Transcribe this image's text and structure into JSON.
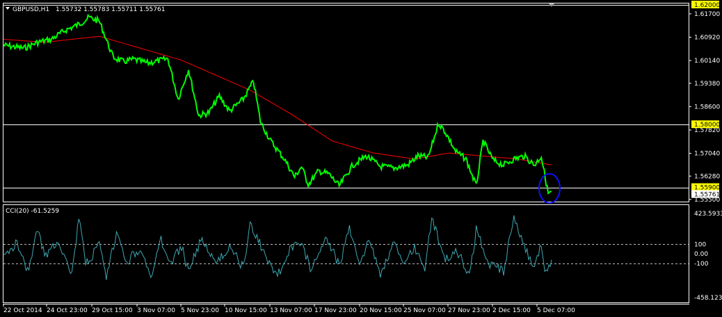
{
  "main_header": {
    "symbol": "GBPUSD,H1",
    "ohlc": "1.55732 1.55783 1.55711 1.55761"
  },
  "indicator_header": {
    "label": "CCI(20) -61.5259"
  },
  "price_axis": {
    "labels": [
      "1.61700",
      "1.60920",
      "1.60140",
      "1.59380",
      "1.58600",
      "1.57820",
      "1.57040",
      "1.56280",
      "1.55500"
    ],
    "hline_tags": [
      "1.62000",
      "1.58000",
      "1.55900"
    ],
    "current_price_tag": "1.55761"
  },
  "cci_axis": {
    "labels": [
      "423.5933",
      "100",
      "0.00",
      "-100",
      "-458.1239"
    ]
  },
  "time_axis": {
    "labels": [
      "22 Oct 2014",
      "24 Oct 23:00",
      "29 Oct 15:00",
      "3 Nov 07:00",
      "5 Nov 23:00",
      "10 Nov 15:00",
      "13 Nov 07:00",
      "17 Nov 23:00",
      "20 Nov 15:00",
      "25 Nov 07:00",
      "27 Nov 23:00",
      "2 Dec 15:00",
      "5 Dec 07:00"
    ]
  },
  "colors": {
    "price_line": "#00ff00",
    "moving_average": "#ff0000",
    "cci_line": "#3fa9b3",
    "horizontal_lines": "#ffffff",
    "tag_background": "#ffff00",
    "highlight_ellipse": "#1010ff"
  },
  "chart_data": {
    "type": "line",
    "title": "GBPUSD,H1",
    "ylim": [
      1.5545,
      1.62
    ],
    "horizontal_lines": [
      1.62,
      1.58,
      1.559
    ],
    "series": [
      {
        "name": "GBPUSD,H1",
        "x_positions": [
          0.0,
          0.03,
          0.05,
          0.07,
          0.09,
          0.11,
          0.125,
          0.14,
          0.16,
          0.175,
          0.19,
          0.21,
          0.24,
          0.255,
          0.27,
          0.285,
          0.3,
          0.315,
          0.33,
          0.35,
          0.365,
          0.375,
          0.39,
          0.41,
          0.425,
          0.435,
          0.445,
          0.46,
          0.475,
          0.49,
          0.51,
          0.53,
          0.55,
          0.57,
          0.59,
          0.605,
          0.62,
          0.635,
          0.645,
          0.66,
          0.675,
          0.69,
          0.7,
          0.715,
          0.73,
          0.745,
          0.76,
          0.775,
          0.785,
          0.795,
          0.8
        ],
        "values": [
          1.6065,
          1.6055,
          1.6075,
          1.6085,
          1.6115,
          1.6135,
          1.6158,
          1.6145,
          1.6025,
          1.601,
          1.6018,
          1.6005,
          1.602,
          1.5885,
          1.5985,
          1.583,
          1.584,
          1.5895,
          1.5845,
          1.5885,
          1.5945,
          1.581,
          1.5745,
          1.5685,
          1.5625,
          1.566,
          1.56,
          1.5645,
          1.5635,
          1.5595,
          1.5665,
          1.5695,
          1.566,
          1.5655,
          1.5665,
          1.5695,
          1.569,
          1.5805,
          1.5775,
          1.571,
          1.5685,
          1.5595,
          1.5745,
          1.568,
          1.5665,
          1.5685,
          1.5695,
          1.5665,
          1.5695,
          1.557,
          1.5576
        ]
      },
      {
        "name": "moving_average",
        "x_positions": [
          0.0,
          0.06,
          0.1,
          0.14,
          0.2,
          0.26,
          0.3,
          0.36,
          0.42,
          0.48,
          0.54,
          0.6,
          0.65,
          0.7,
          0.75,
          0.8
        ],
        "values": [
          1.6085,
          1.6075,
          1.6085,
          1.6095,
          1.6055,
          1.6015,
          1.5975,
          1.5915,
          1.5835,
          1.5745,
          1.5705,
          1.5685,
          1.5705,
          1.5695,
          1.5685,
          1.5665
        ]
      },
      {
        "name": "CCI(20)",
        "ylim": [
          -458.1239,
          423.5933
        ],
        "reference_levels": [
          100,
          0,
          -100
        ],
        "x_positions": [
          0.0,
          0.02,
          0.035,
          0.05,
          0.06,
          0.08,
          0.1,
          0.11,
          0.12,
          0.14,
          0.15,
          0.165,
          0.18,
          0.2,
          0.215,
          0.23,
          0.245,
          0.26,
          0.27,
          0.29,
          0.31,
          0.33,
          0.35,
          0.36,
          0.38,
          0.4,
          0.42,
          0.435,
          0.45,
          0.47,
          0.49,
          0.505,
          0.52,
          0.535,
          0.55,
          0.57,
          0.585,
          0.6,
          0.615,
          0.625,
          0.645,
          0.66,
          0.68,
          0.69,
          0.71,
          0.73,
          0.745,
          0.76,
          0.775,
          0.785,
          0.79,
          0.8
        ],
        "values": [
          -50,
          130,
          -180,
          260,
          -30,
          150,
          -220,
          380,
          -120,
          90,
          -260,
          210,
          -80,
          60,
          -250,
          140,
          -100,
          80,
          -190,
          170,
          -120,
          90,
          -150,
          310,
          20,
          -230,
          60,
          110,
          -180,
          200,
          -120,
          260,
          -90,
          150,
          -210,
          120,
          -130,
          80,
          -150,
          380,
          -80,
          60,
          -230,
          250,
          -120,
          -180,
          400,
          60,
          -120,
          100,
          -200,
          -62
        ]
      }
    ]
  }
}
